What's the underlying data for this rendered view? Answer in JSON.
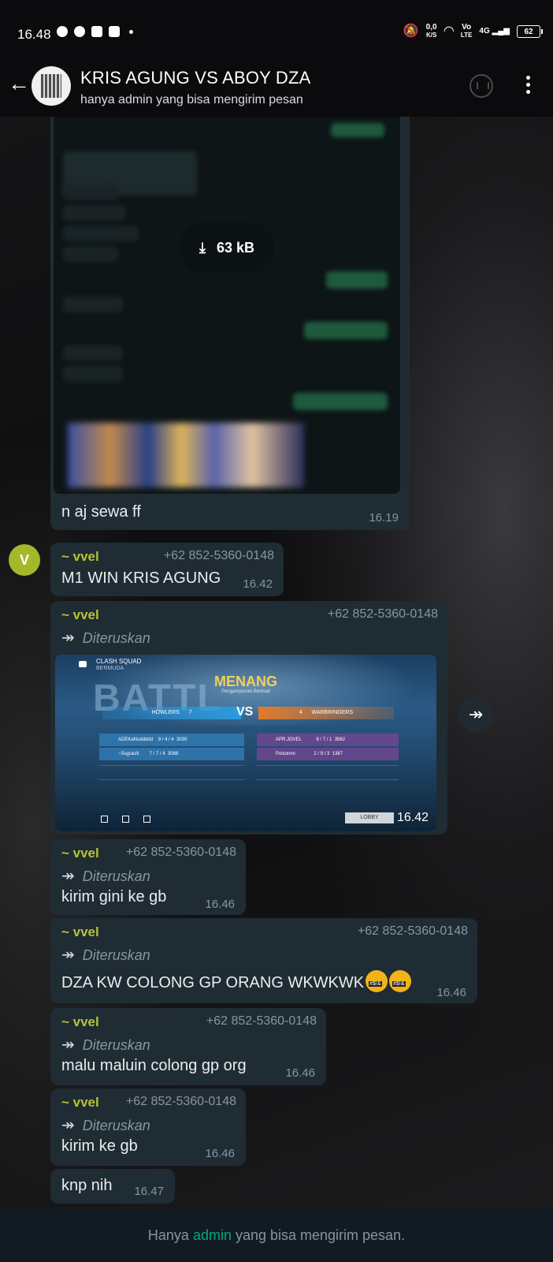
{
  "status_bar": {
    "time": "16.48",
    "net_speed_value": "0,0",
    "net_speed_unit": "K/S",
    "volte_top": "Vo",
    "volte_bottom": "LTE",
    "network_type": "4G",
    "battery": "62"
  },
  "header": {
    "title": "KRIS AGUNG VS ABOY DZA",
    "subtitle": "hanya admin yang bisa mengirim pesan"
  },
  "messages": [
    {
      "type": "image",
      "download_size": "63 kB",
      "caption": "n aj sewa ff",
      "time": "16.19"
    },
    {
      "type": "text",
      "avatar_letter": "V",
      "sender": "~ vvel",
      "phone": "+62 852-5360-0148",
      "text": "M1 WIN KRIS AGUNG",
      "time": "16.42"
    },
    {
      "type": "forwarded_image",
      "sender": "~ vvel",
      "phone": "+62 852-5360-0148",
      "forwarded_label": "Diteruskan",
      "time": "16.42",
      "game": {
        "mode": "CLASH SQUAD",
        "map": "BERMUDA",
        "result": "MENANG",
        "result_sub": "Pengampunan Berbuat",
        "team_left": "HOWLERS",
        "score_left": "7",
        "vs": "VS",
        "score_right": "4",
        "team_right": "WARBRINGERS",
        "players_left": [
          {
            "name": "ADEKaNuddddd",
            "kda": "9 / 4 / 4",
            "dmg": "3030"
          },
          {
            "name": "~Ssgracill",
            "kda": "7 / 7 / 4",
            "dmg": "3068"
          }
        ],
        "players_right": [
          {
            "name": "APR.JOVEL",
            "kda": "9 / 7 / 1",
            "dmg": "3562"
          },
          {
            "name": "Poisonnn",
            "kda": "2 / 9 / 3",
            "dmg": "1387"
          }
        ],
        "lobby_label": "LOBBY"
      }
    },
    {
      "type": "forwarded_text",
      "sender": "~ vvel",
      "phone": "+62 852-5360-0148",
      "forwarded_label": "Diteruskan",
      "text": "kirim gini ke gb",
      "time": "16.46"
    },
    {
      "type": "forwarded_text",
      "sender": "~ vvel",
      "phone": "+62 852-5360-0148",
      "forwarded_label": "Diteruskan",
      "text": "DZA KW COLONG GP ORANG WKWKWK",
      "emoji": "face-with-symbols-on-mouth",
      "time": "16.46"
    },
    {
      "type": "forwarded_text",
      "sender": "~ vvel",
      "phone": "+62 852-5360-0148",
      "forwarded_label": "Diteruskan",
      "text": "malu maluin colong gp org",
      "time": "16.46"
    },
    {
      "type": "forwarded_text",
      "sender": "~ vvel",
      "phone": "+62 852-5360-0148",
      "forwarded_label": "Diteruskan",
      "text": "kirim ke gb",
      "time": "16.46"
    },
    {
      "type": "text",
      "text": "knp nih",
      "time": "16.47"
    }
  ],
  "footer": {
    "pre": "Hanya",
    "highlight": "admin",
    "post": "yang bisa mengirim pesan."
  },
  "colors": {
    "bubble": "#202c33",
    "sender": "#b5c336",
    "accent": "#00a884",
    "meta": "#8696a0"
  }
}
